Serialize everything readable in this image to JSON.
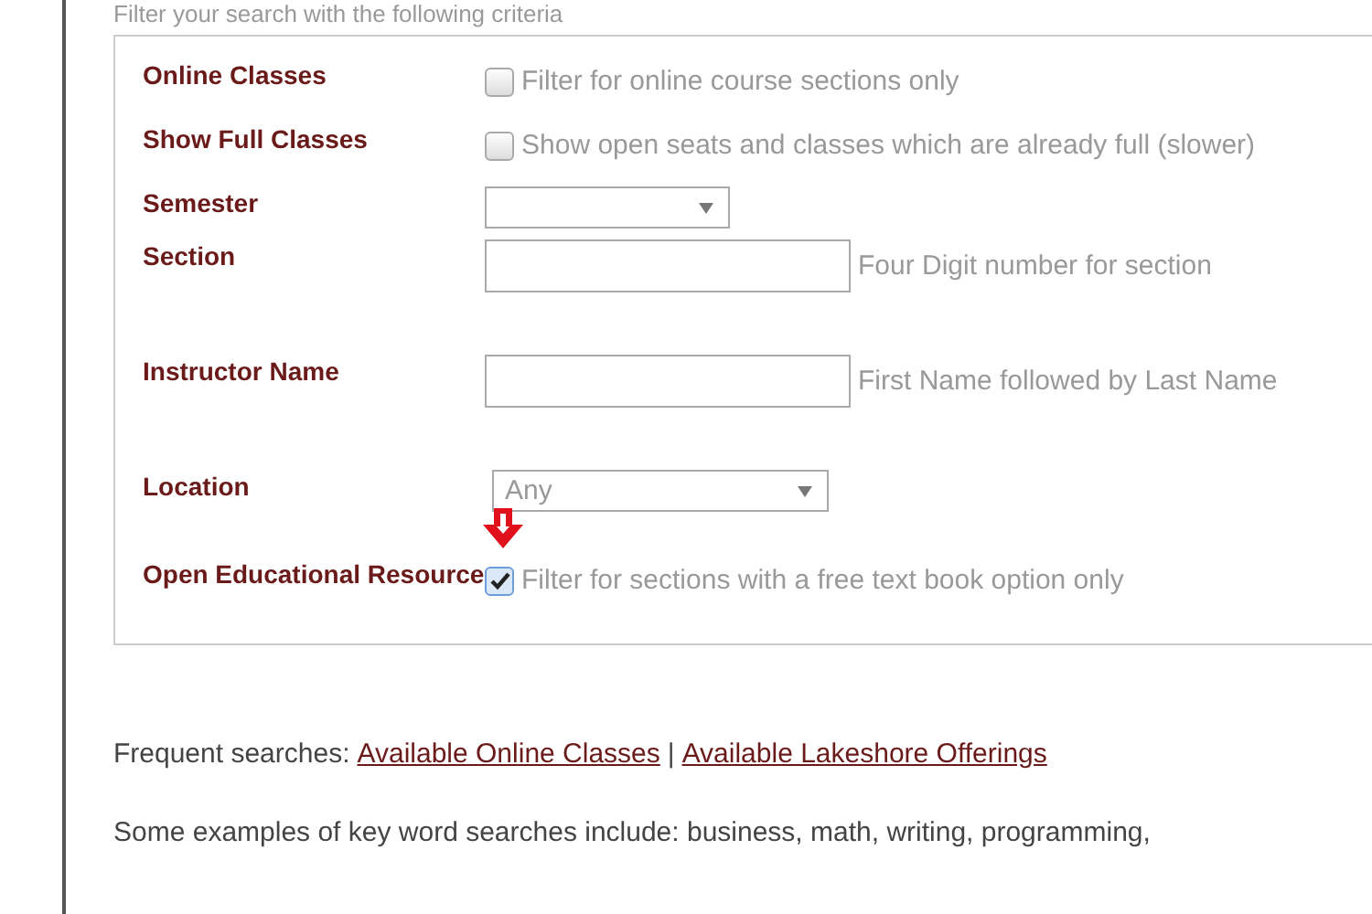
{
  "intro": "Filter your search with the following criteria",
  "filters": [
    {
      "kind": "checkbox",
      "label": "Online Classes",
      "checked": false,
      "text": "Filter for online course sections only"
    },
    {
      "kind": "checkbox",
      "label": "Show Full Classes",
      "checked": false,
      "text": "Show open seats and classes which are already full (slower)"
    },
    {
      "kind": "select",
      "label": "Semester"
    },
    {
      "kind": "text",
      "label": "Section",
      "hint": "Four Digit number for section"
    },
    {
      "kind": "text",
      "label": "Instructor Name",
      "hint": "First Name followed by Last Name"
    },
    {
      "kind": "select",
      "label": "Location",
      "value": "Any"
    },
    {
      "kind": "checkbox",
      "label": "Open Educational Resource",
      "checked": true,
      "text": "Filter for sections with a free text book option only",
      "pointer": true
    }
  ],
  "frequent": {
    "label": "Frequent searches:",
    "links": [
      "Available Online Classes",
      "Available Lakeshore Offerings"
    ],
    "separator": "|"
  },
  "examples": "Some examples of key word searches include: business, math, writing, programming,"
}
